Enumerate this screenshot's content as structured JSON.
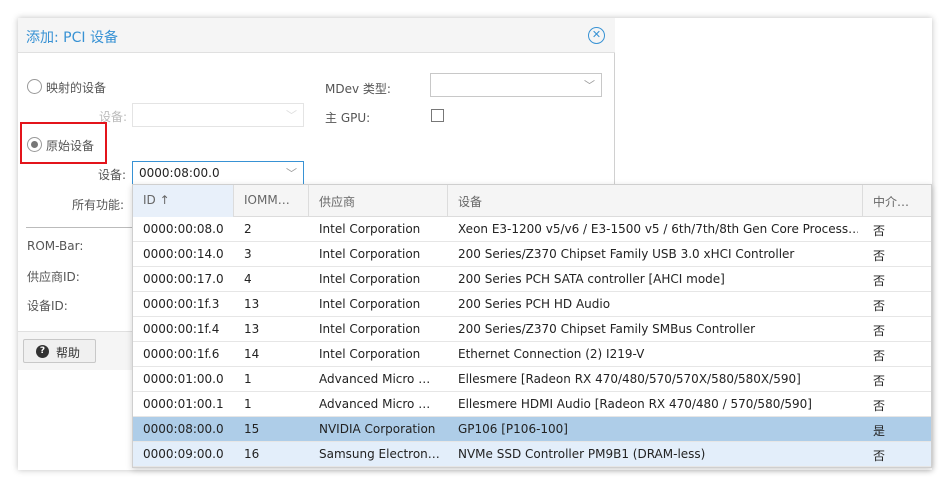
{
  "dialog": {
    "title": "添加: PCI 设备",
    "mapped_device_label": "映射的设备",
    "device_label": "设备:",
    "raw_device_label": "原始设备",
    "device_value": "0000:08:00.0",
    "all_functions_label": "所有功能:",
    "mdev_type_label": "MDev 类型:",
    "main_gpu_label": "主 GPU:",
    "rombar_label": "ROM-Bar:",
    "vendor_id_label": "供应商ID:",
    "device_id_label": "设备ID:",
    "help_label": "帮助",
    "close_glyph": "✕",
    "help_glyph": "?",
    "chevron": "﹀"
  },
  "grid": {
    "columns": {
      "id": "ID ↑",
      "iommu": "IOMM…",
      "vendor": "供应商",
      "device": "设备",
      "mediated": "中介…"
    },
    "rows": [
      {
        "id": "0000:00:08.0",
        "iommu": "2",
        "vendor": "Intel Corporation",
        "device": "Xeon E3-1200 v5/v6 / E3-1500 v5 / 6th/7th/8th Gen Core Process…",
        "mediated": "否"
      },
      {
        "id": "0000:00:14.0",
        "iommu": "3",
        "vendor": "Intel Corporation",
        "device": "200 Series/Z370 Chipset Family USB 3.0 xHCI Controller",
        "mediated": "否"
      },
      {
        "id": "0000:00:17.0",
        "iommu": "4",
        "vendor": "Intel Corporation",
        "device": "200 Series PCH SATA controller [AHCI mode]",
        "mediated": "否"
      },
      {
        "id": "0000:00:1f.3",
        "iommu": "13",
        "vendor": "Intel Corporation",
        "device": "200 Series PCH HD Audio",
        "mediated": "否"
      },
      {
        "id": "0000:00:1f.4",
        "iommu": "13",
        "vendor": "Intel Corporation",
        "device": "200 Series/Z370 Chipset Family SMBus Controller",
        "mediated": "否"
      },
      {
        "id": "0000:00:1f.6",
        "iommu": "14",
        "vendor": "Intel Corporation",
        "device": "Ethernet Connection (2) I219-V",
        "mediated": "否"
      },
      {
        "id": "0000:01:00.0",
        "iommu": "1",
        "vendor": "Advanced Micro …",
        "device": "Ellesmere [Radeon RX 470/480/570/570X/580/580X/590]",
        "mediated": "否"
      },
      {
        "id": "0000:01:00.1",
        "iommu": "1",
        "vendor": "Advanced Micro …",
        "device": "Ellesmere HDMI Audio [Radeon RX 470/480 / 570/580/590]",
        "mediated": "否"
      },
      {
        "id": "0000:08:00.0",
        "iommu": "15",
        "vendor": "NVIDIA Corporation",
        "device": "GP106 [P106-100]",
        "mediated": "是"
      },
      {
        "id": "0000:09:00.0",
        "iommu": "16",
        "vendor": "Samsung Electron…",
        "device": "NVMe SSD Controller PM9B1 (DRAM-less)",
        "mediated": "否"
      }
    ]
  },
  "colors": {
    "accent": "#3892d4",
    "highlight_border": "#e3141b",
    "selected_row": "#aecde8",
    "hover_row": "#e3eefa"
  }
}
